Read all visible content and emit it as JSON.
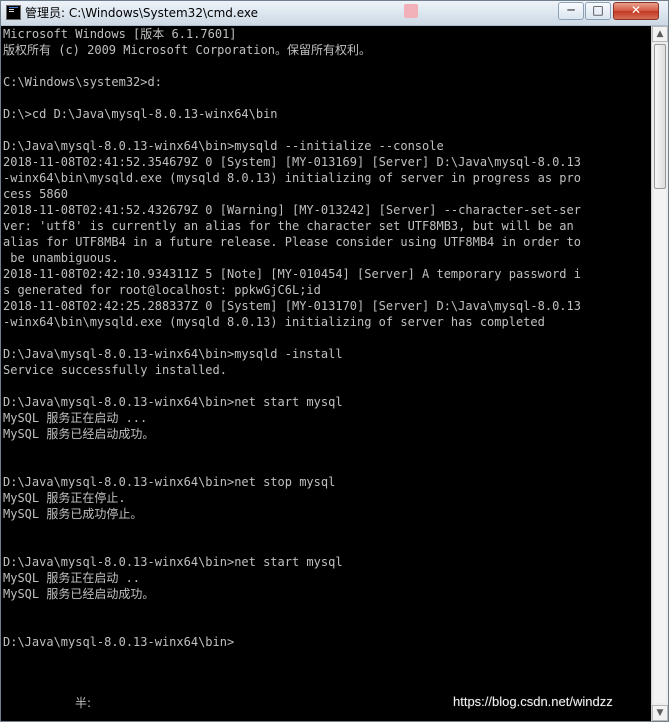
{
  "window": {
    "title": "管理员: C:\\Windows\\System32\\cmd.exe",
    "icon": "cmd-icon"
  },
  "controls": {
    "minimize": "─",
    "maximize": "□",
    "close": "✕"
  },
  "console_lines": [
    "Microsoft Windows [版本 6.1.7601]",
    "版权所有 (c) 2009 Microsoft Corporation。保留所有权利。",
    "",
    "C:\\Windows\\system32>d:",
    "",
    "D:\\>cd D:\\Java\\mysql-8.0.13-winx64\\bin",
    "",
    "D:\\Java\\mysql-8.0.13-winx64\\bin>mysqld --initialize --console",
    "2018-11-08T02:41:52.354679Z 0 [System] [MY-013169] [Server] D:\\Java\\mysql-8.0.13",
    "-winx64\\bin\\mysqld.exe (mysqld 8.0.13) initializing of server in progress as pro",
    "cess 5860",
    "2018-11-08T02:41:52.432679Z 0 [Warning] [MY-013242] [Server] --character-set-ser",
    "ver: 'utf8' is currently an alias for the character set UTF8MB3, but will be an",
    "alias for UTF8MB4 in a future release. Please consider using UTF8MB4 in order to",
    " be unambiguous.",
    "2018-11-08T02:42:10.934311Z 5 [Note] [MY-010454] [Server] A temporary password i",
    "s generated for root@localhost: ppkwGjC6L;id",
    "2018-11-08T02:42:25.288337Z 0 [System] [MY-013170] [Server] D:\\Java\\mysql-8.0.13",
    "-winx64\\bin\\mysqld.exe (mysqld 8.0.13) initializing of server has completed",
    "",
    "D:\\Java\\mysql-8.0.13-winx64\\bin>mysqld -install",
    "Service successfully installed.",
    "",
    "D:\\Java\\mysql-8.0.13-winx64\\bin>net start mysql",
    "MySQL 服务正在启动 ...",
    "MySQL 服务已经启动成功。",
    "",
    "",
    "D:\\Java\\mysql-8.0.13-winx64\\bin>net stop mysql",
    "MySQL 服务正在停止.",
    "MySQL 服务已成功停止。",
    "",
    "",
    "D:\\Java\\mysql-8.0.13-winx64\\bin>net start mysql",
    "MySQL 服务正在启动 ..",
    "MySQL 服务已经启动成功。",
    "",
    "",
    "D:\\Java\\mysql-8.0.13-winx64\\bin>"
  ],
  "ime_indicator": "半:",
  "watermark": "https://blog.csdn.net/windzz",
  "scrollbar": {
    "position_fraction": 0.0,
    "visible_fraction": 0.22
  },
  "colors": {
    "console_background": "#000000",
    "console_text": "#c0c0c0",
    "title_text": "#000000",
    "close_button": "#c23922"
  }
}
